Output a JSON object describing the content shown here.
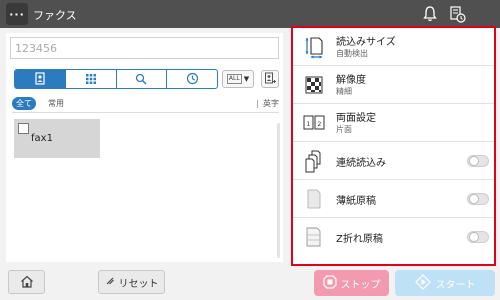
{
  "topbar": {
    "menu_label": "···",
    "title": "ファクス",
    "icons": [
      "bell-icon",
      "job-status-icon"
    ]
  },
  "address": {
    "placeholder": "123456"
  },
  "tabs": [
    {
      "icon": "address-book-icon",
      "active": true
    },
    {
      "icon": "keypad-icon",
      "active": false
    },
    {
      "icon": "search-icon",
      "active": false
    },
    {
      "icon": "history-icon",
      "active": false
    }
  ],
  "sort": {
    "label": "ALL"
  },
  "filters": {
    "all": "全て",
    "common": "常用",
    "alpha": "英字"
  },
  "destinations": [
    {
      "name": "fax1",
      "checked": false
    }
  ],
  "settings": [
    {
      "title": "読込みサイズ",
      "value": "自動検出",
      "icon": "scan-size-icon"
    },
    {
      "title": "解像度",
      "value": "精細",
      "icon": "resolution-icon"
    },
    {
      "title": "両面設定",
      "value": "片面",
      "icon": "duplex-icon"
    },
    {
      "title": "連続読込み",
      "toggle": false,
      "icon": "continuous-scan-icon"
    },
    {
      "title": "薄紙原稿",
      "toggle": false,
      "icon": "thin-paper-icon"
    },
    {
      "title": "Z折れ原稿",
      "toggle": false,
      "icon": "z-folded-icon"
    }
  ],
  "bottom": {
    "reset": "リセット",
    "stop": "ストップ",
    "start": "スタート"
  },
  "colors": {
    "accent": "#2c7bbf",
    "highlight_border": "#e0001b",
    "stop": "#f29bb0",
    "start": "#bfe1f6"
  }
}
